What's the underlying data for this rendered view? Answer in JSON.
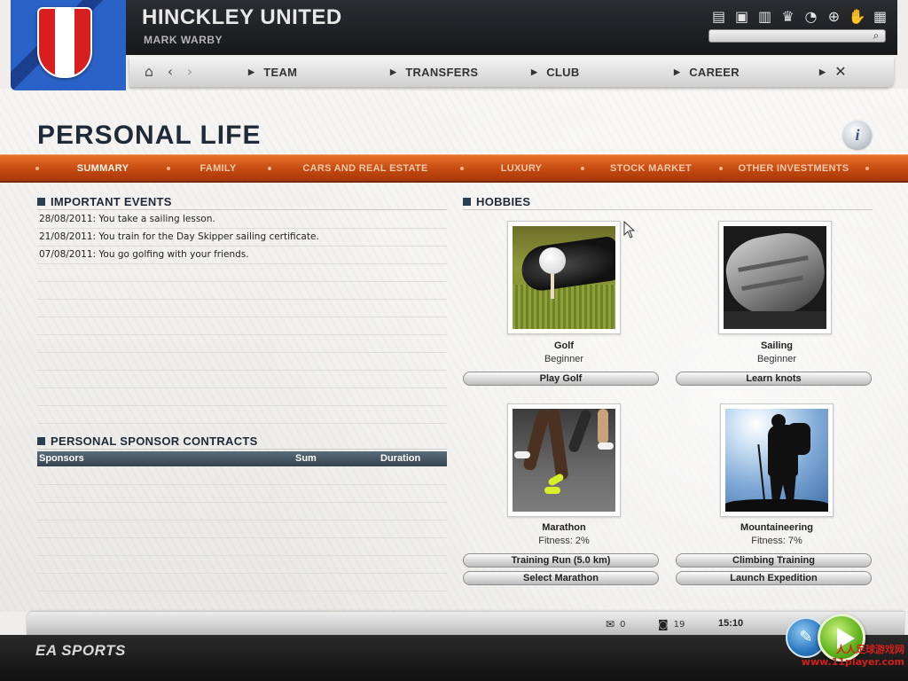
{
  "header": {
    "club_name": "HINCKLEY UNITED",
    "manager_name": "MARK WARBY",
    "icons": [
      "newspaper-icon",
      "tv-icon",
      "stats-icon",
      "trophy-icon",
      "loading-icon",
      "globe-icon",
      "handshake-icon",
      "document-icon"
    ],
    "search": {
      "value": "",
      "placeholder": ""
    }
  },
  "nav": {
    "icons": [
      "home-icon",
      "back-icon",
      "forward-icon",
      "tools-icon"
    ],
    "items": [
      {
        "label": "TEAM"
      },
      {
        "label": "TRANSFERS"
      },
      {
        "label": "CLUB"
      },
      {
        "label": "CAREER"
      }
    ]
  },
  "page": {
    "title": "PERSONAL LIFE",
    "info_label": "i"
  },
  "tabs": [
    {
      "label": "SUMMARY",
      "active": true
    },
    {
      "label": "FAMILY",
      "active": false
    },
    {
      "label": "CARS AND REAL ESTATE",
      "active": false
    },
    {
      "label": "LUXURY",
      "active": false
    },
    {
      "label": "STOCK MARKET",
      "active": false
    },
    {
      "label": "OTHER INVESTMENTS",
      "active": false
    }
  ],
  "important_events": {
    "title": "IMPORTANT EVENTS",
    "events": [
      "28/08/2011: You take a sailing lesson.",
      "21/08/2011: You train for the Day Skipper sailing certificate.",
      "07/08/2011: You go golfing with your friends."
    ]
  },
  "sponsor_contracts": {
    "title": "PERSONAL SPONSOR CONTRACTS",
    "columns": [
      "Sponsors",
      "Sum",
      "Duration"
    ],
    "rows": []
  },
  "hobbies": {
    "title": "HOBBIES",
    "items": [
      {
        "name": "Golf",
        "level": "Beginner",
        "buttons": [
          "Play Golf"
        ]
      },
      {
        "name": "Sailing",
        "level": "Beginner",
        "buttons": [
          "Learn knots"
        ]
      },
      {
        "name": "Marathon",
        "level": "Fitness: 2%",
        "buttons": [
          "Training Run (5.0 km)",
          "Select Marathon"
        ]
      },
      {
        "name": "Mountaineering",
        "level": "Fitness: 7%",
        "buttons": [
          "Climbing Training",
          "Launch Expedition"
        ]
      }
    ]
  },
  "footer": {
    "brand": "EA SPORTS",
    "messages_count": "0",
    "notifications_count": "19",
    "time": "15:10",
    "watermark_line1": "人人足球游戏网",
    "watermark_line2": "www.11player.com"
  },
  "colors": {
    "tab_bar": "#c44a12",
    "header_blue": "#2a62c7",
    "crest_red": "#d81e1e",
    "continue_green": "#5fb11d"
  }
}
